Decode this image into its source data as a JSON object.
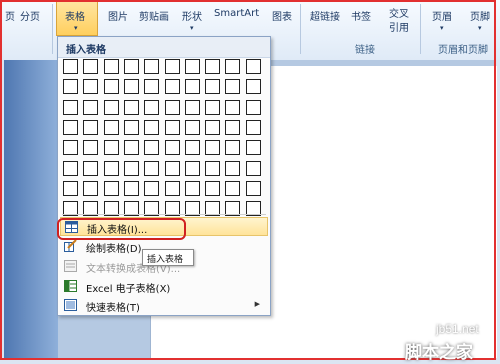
{
  "ribbon": {
    "page_label": "页",
    "page_break_label": "分页",
    "tables_label": "表格",
    "picture_label": "图片",
    "clipart_label": "剪贴画",
    "shapes_label": "形状",
    "smartart_label": "SmartArt",
    "chart_label": "图表",
    "hyperlink_label": "超链接",
    "bookmark_label": "书签",
    "crossref_label": "交叉引用",
    "header_label": "页眉",
    "footer_label": "页脚",
    "links_group": "链接",
    "header_footer_group": "页眉和页脚"
  },
  "menu": {
    "title": "插入表格",
    "grid": {
      "columns": 10,
      "rows": 8
    },
    "items": [
      {
        "label": "插入表格(I)...",
        "icon": "table-icon",
        "highlighted": true
      },
      {
        "label": "绘制表格(D)",
        "icon": "draw-table-icon"
      },
      {
        "label": "文本转换成表格(V)...",
        "icon": "convert-text-icon",
        "disabled": true
      },
      {
        "label": "Excel 电子表格(X)",
        "icon": "excel-icon"
      },
      {
        "label": "快速表格(T)",
        "icon": "quick-tables-icon",
        "submenu": true
      }
    ]
  },
  "tooltip": {
    "text": "插入表格"
  },
  "watermark": {
    "site": "jb51.net",
    "name": "脚本之家"
  },
  "colors": {
    "accent": "#ffcf5e",
    "highlight_border": "#d02020",
    "ribbon_text": "#1e3a64"
  }
}
